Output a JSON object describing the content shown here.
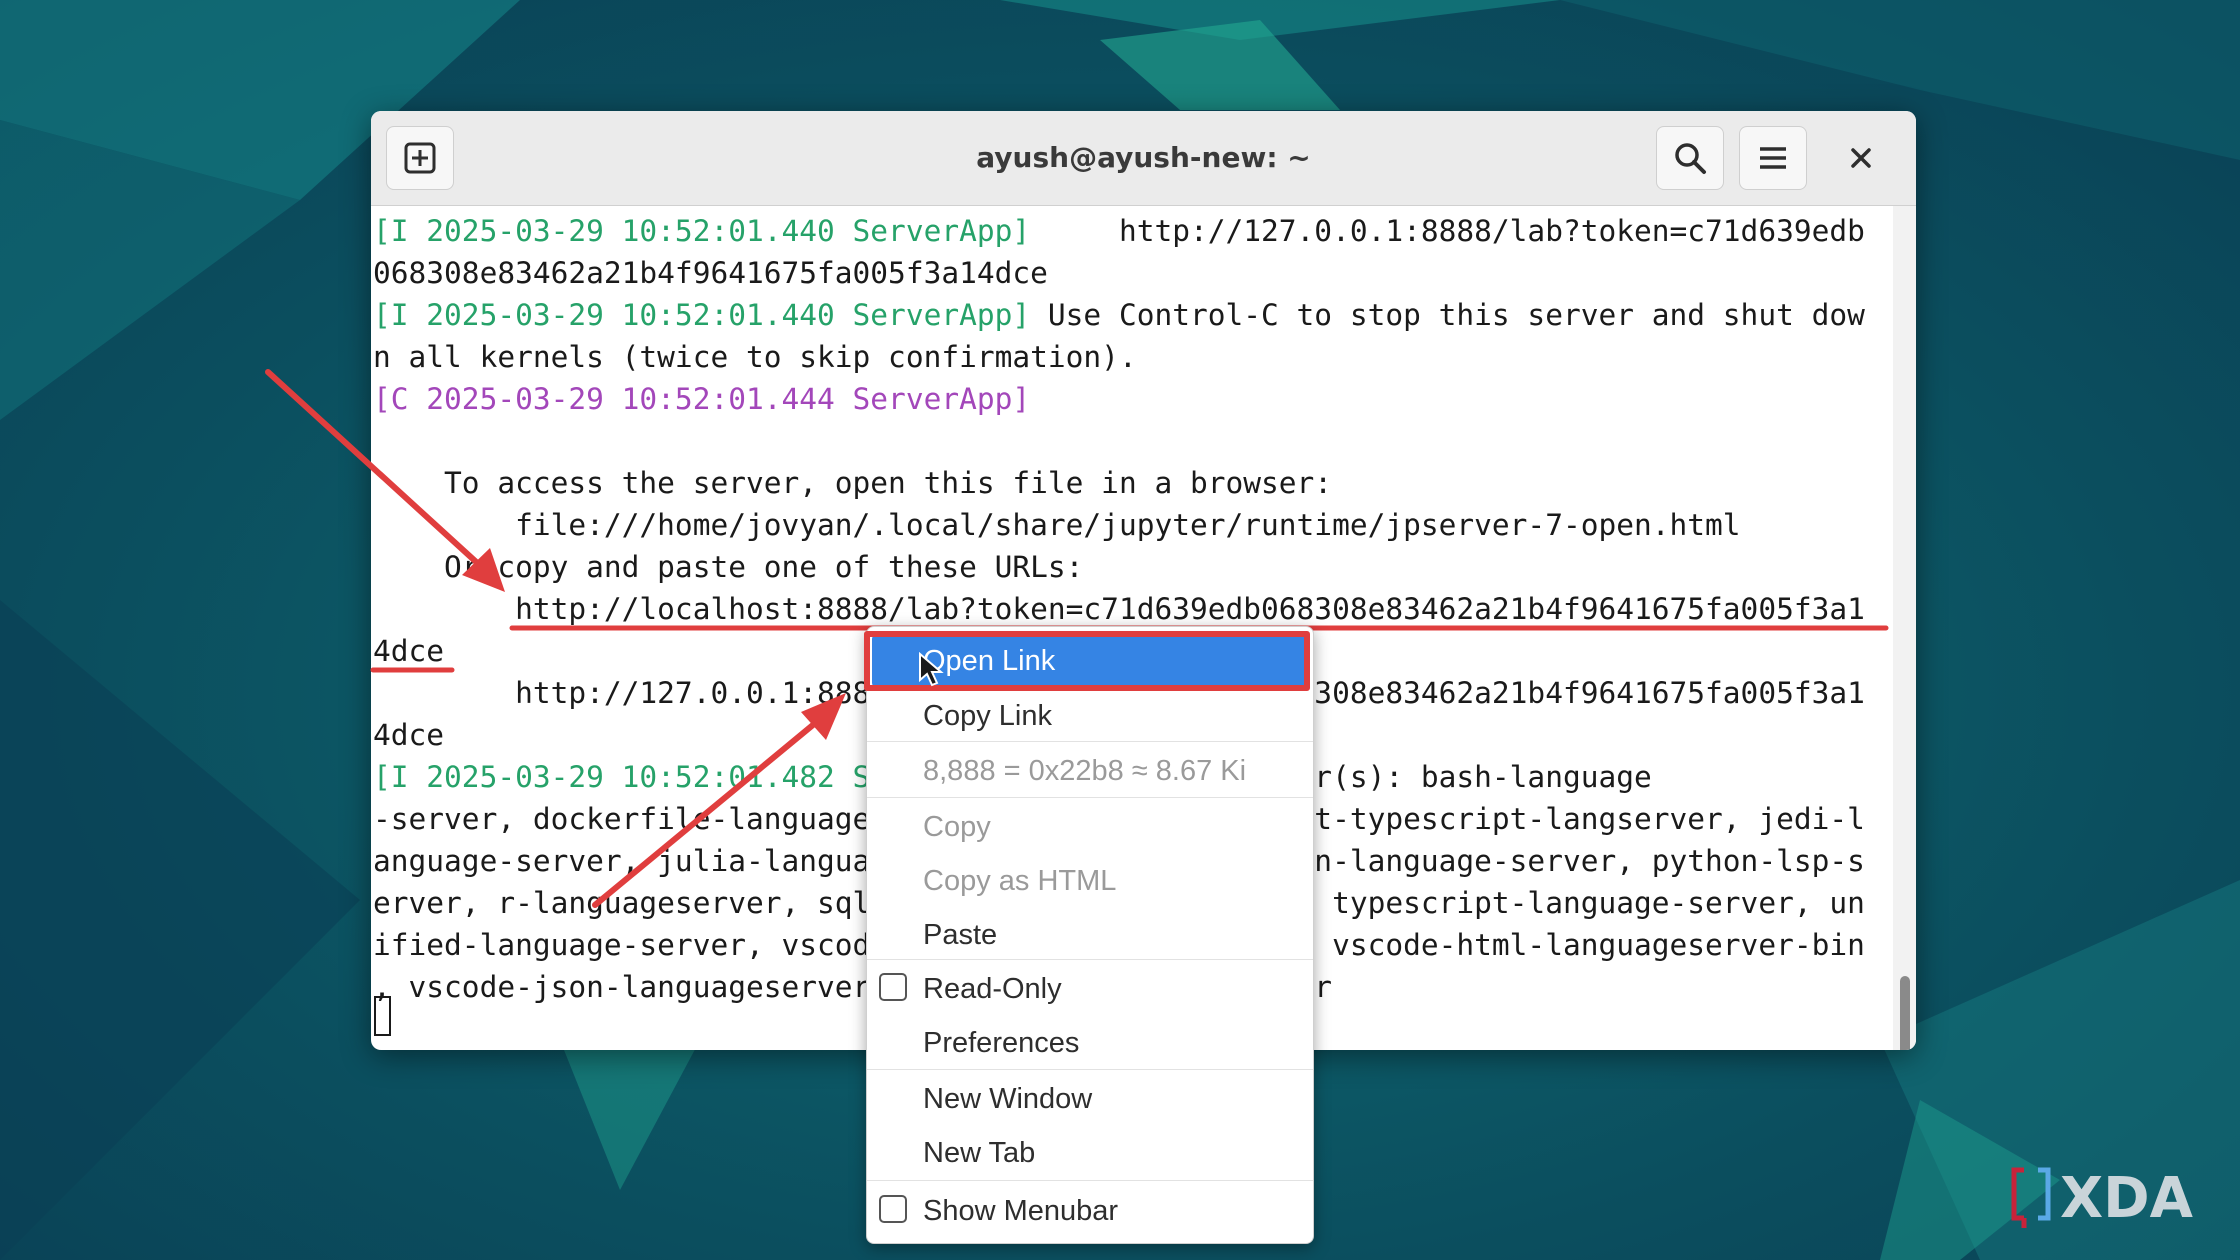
{
  "window": {
    "title": "ayush@ayush-new: ~"
  },
  "terminal": {
    "lines": [
      {
        "prefix": "[I 2025-03-29 10:52:01.440 ServerApp]",
        "prefix_color": "green",
        "text": "     http://127.0.0.1:8888/lab?token=c71d639edb"
      },
      {
        "prefix": "",
        "prefix_color": "",
        "text": "068308e83462a21b4f9641675fa005f3a14dce"
      },
      {
        "prefix": "[I 2025-03-29 10:52:01.440 ServerApp]",
        "prefix_color": "green",
        "text": " Use Control-C to stop this server and shut dow"
      },
      {
        "prefix": "",
        "prefix_color": "",
        "text": "n all kernels (twice to skip confirmation)."
      },
      {
        "prefix": "[C 2025-03-29 10:52:01.444 ServerApp]",
        "prefix_color": "purple",
        "text": ""
      },
      {
        "prefix": "",
        "prefix_color": "",
        "text": ""
      },
      {
        "prefix": "",
        "prefix_color": "",
        "text": "    To access the server, open this file in a browser:"
      },
      {
        "prefix": "",
        "prefix_color": "",
        "text": "        file:///home/jovyan/.local/share/jupyter/runtime/jpserver-7-open.html"
      },
      {
        "prefix": "",
        "prefix_color": "",
        "text": "    Or copy and paste one of these URLs:"
      },
      {
        "prefix": "",
        "prefix_color": "",
        "text": "        http://localhost:8888/lab?token=c71d639edb068308e83462a21b4f9641675fa005f3a1"
      },
      {
        "prefix": "",
        "prefix_color": "",
        "text": "4dce"
      },
      {
        "prefix": "",
        "prefix_color": "",
        "text": "        http://127.0.0.1:8888/lab?token=c71d639edb068308e83462a21b4f9641675fa005f3a1"
      },
      {
        "prefix": "",
        "prefix_color": "",
        "text": "4dce"
      },
      {
        "prefix": "[I 2025-03-29 10:52:01.482 ServerApp]",
        "prefix_color": "green",
        "text": " installed server(s): bash-language"
      },
      {
        "prefix": "",
        "prefix_color": "",
        "text": "-server, dockerfile-language-server-nodejs, javascript-typescript-langserver, jedi-l"
      },
      {
        "prefix": "",
        "prefix_color": "",
        "text": "anguage-server, julia-language-server, pyright, python-language-server, python-lsp-s"
      },
      {
        "prefix": "",
        "prefix_color": "",
        "text": "erver, r-languageserver, sql-language-server, texlab, typescript-language-server, un"
      },
      {
        "prefix": "",
        "prefix_color": "",
        "text": "ified-language-server, vscode-css-languageserver-bin, vscode-html-languageserver-bin"
      },
      {
        "prefix": "",
        "prefix_color": "",
        "text": ", vscode-json-languageserver-bin, yaml-language-server"
      }
    ]
  },
  "context_menu": {
    "items": [
      {
        "label": "Open Link",
        "type": "item",
        "state": "active"
      },
      {
        "label": "Copy Link",
        "type": "item",
        "state": "normal"
      },
      {
        "label": "8,888 = 0x22b8 ≈ 8.67 Ki",
        "type": "item",
        "state": "disabled"
      },
      {
        "label": "Copy",
        "type": "item",
        "state": "disabled"
      },
      {
        "label": "Copy as HTML",
        "type": "item",
        "state": "disabled"
      },
      {
        "label": "Paste",
        "type": "item",
        "state": "normal"
      },
      {
        "label": "Read-Only",
        "type": "check",
        "state": "normal"
      },
      {
        "label": "Preferences",
        "type": "item",
        "state": "normal"
      },
      {
        "label": "New Window",
        "type": "item",
        "state": "normal"
      },
      {
        "label": "New Tab",
        "type": "item",
        "state": "normal"
      },
      {
        "label": "Show Menubar",
        "type": "check",
        "state": "normal"
      }
    ]
  },
  "watermark": {
    "text": "XDA"
  },
  "colors": {
    "terminal_green": "#26a269",
    "terminal_purple": "#a347ba",
    "menu_highlight": "#3584e4",
    "annotation_red": "#e03e3e",
    "desktop_bg": "#0d4f5e"
  },
  "icons": {
    "new_tab": "new-tab-icon",
    "search": "search-icon",
    "menu": "hamburger-menu-icon",
    "close": "close-icon"
  }
}
